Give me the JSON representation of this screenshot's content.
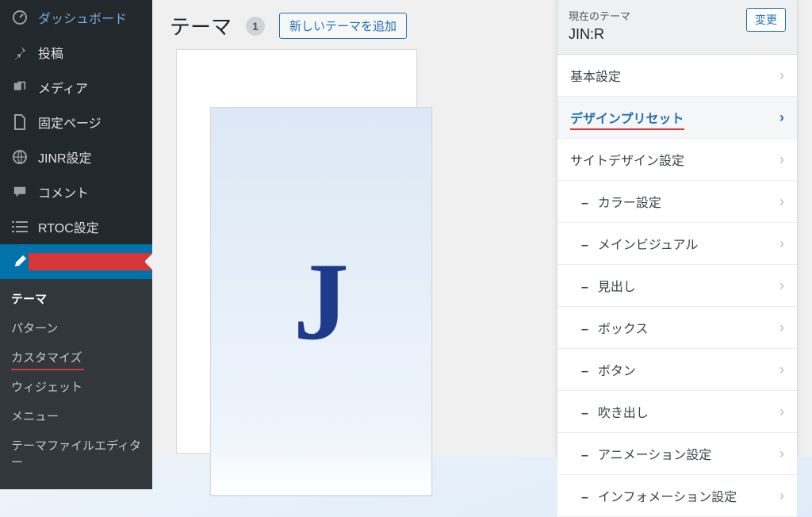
{
  "sidebar": {
    "items": [
      {
        "label": "ダッシュボード"
      },
      {
        "label": "投稿"
      },
      {
        "label": "メディア"
      },
      {
        "label": "固定ページ"
      },
      {
        "label": "JINR設定"
      },
      {
        "label": "コメント"
      },
      {
        "label": "RTOC設定"
      },
      {
        "label": "外観"
      }
    ],
    "subitems": [
      {
        "label": "テーマ"
      },
      {
        "label": "パターン"
      },
      {
        "label": "カスタマイズ"
      },
      {
        "label": "ウィジェット"
      },
      {
        "label": "メニュー"
      },
      {
        "label": "テーマファイルエディター"
      }
    ]
  },
  "header": {
    "title": "テーマ",
    "count": "1",
    "add_button": "新しいテーマを追加"
  },
  "theme_card": {
    "letter": "J"
  },
  "panel": {
    "current_theme_label": "現在のテーマ",
    "current_theme_name": "JIN:R",
    "change_button": "変更",
    "rows": [
      {
        "label": "基本設定",
        "type": "top"
      },
      {
        "label": "デザインプリセット",
        "type": "highlight"
      },
      {
        "label": "サイトデザイン設定",
        "type": "section"
      },
      {
        "label": "カラー設定",
        "type": "sub"
      },
      {
        "label": "メインビジュアル",
        "type": "sub"
      },
      {
        "label": "見出し",
        "type": "sub"
      },
      {
        "label": "ボックス",
        "type": "sub"
      },
      {
        "label": "ボタン",
        "type": "sub"
      },
      {
        "label": "吹き出し",
        "type": "sub"
      },
      {
        "label": "アニメーション設定",
        "type": "sub"
      },
      {
        "label": "インフォメーション設定",
        "type": "sub"
      }
    ]
  }
}
